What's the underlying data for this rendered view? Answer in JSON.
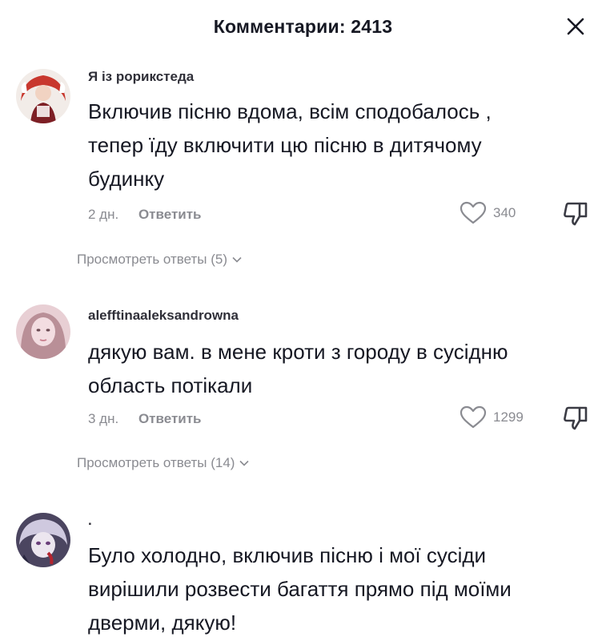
{
  "header": {
    "title": "Комментарии: 2413"
  },
  "comments": [
    {
      "username": "Я із рориксте​да",
      "text_lines": [
        "Включив пісню вдома, всім сподобалось ,",
        "тепер їду включити цю пісню в дитячому",
        "будинку"
      ],
      "date": "2 дн.",
      "reply_label": "Ответить",
      "likes": "340",
      "view_replies": "Просмотреть ответы (5)"
    },
    {
      "username": "alefftinaaleksandrowna",
      "text_lines": [
        "дякую вам. в мене кроти з городу в сусідню",
        "область потікали"
      ],
      "date": "3 дн.",
      "reply_label": "Ответить",
      "likes": "1299",
      "view_replies": "Просмотреть ответы (14)"
    },
    {
      "username": ".",
      "text_lines": [
        "Було холодно, включив пісню і мої сусіди",
        "вирішили розвести багаття прямо під моїми",
        "дверми, дякую!"
      ]
    }
  ],
  "icons": {
    "close": "close-icon",
    "like": "heart-outline-icon",
    "dislike": "thumbs-down-icon",
    "expand": "chevron-down-icon"
  },
  "colors": {
    "text": "#161823",
    "secondary": "#8a8b91",
    "background": "#ffffff"
  }
}
